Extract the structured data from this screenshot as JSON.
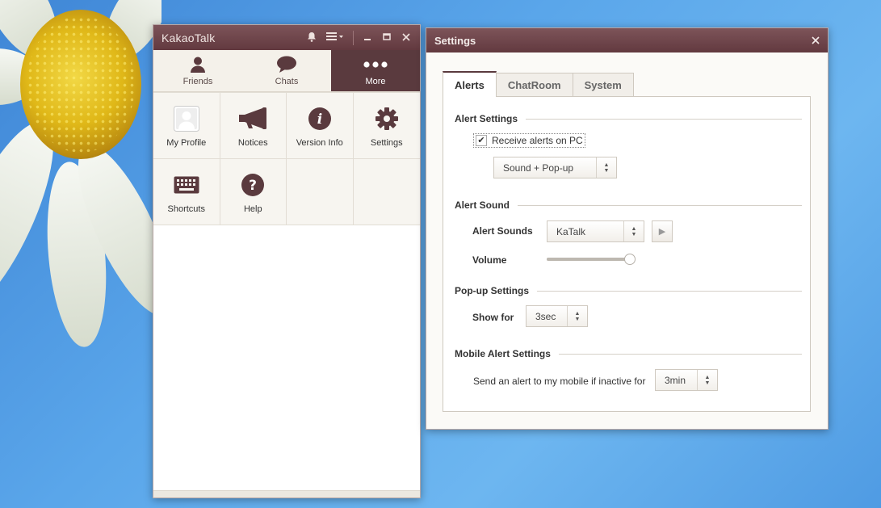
{
  "kakao": {
    "title": "KakaoTalk",
    "tabs": [
      {
        "label": "Friends",
        "icon": "person-icon"
      },
      {
        "label": "Chats",
        "icon": "speech-bubble-icon"
      },
      {
        "label": "More",
        "icon": "more-dots-icon",
        "active": true
      }
    ],
    "more_items": [
      {
        "label": "My Profile",
        "icon": "profile-avatar-icon"
      },
      {
        "label": "Notices",
        "icon": "megaphone-icon"
      },
      {
        "label": "Version Info",
        "icon": "info-icon"
      },
      {
        "label": "Settings",
        "icon": "gear-icon"
      },
      {
        "label": "Shortcuts",
        "icon": "keyboard-icon"
      },
      {
        "label": "Help",
        "icon": "question-icon"
      }
    ]
  },
  "settings": {
    "title": "Settings",
    "tabs": [
      "Alerts",
      "ChatRoom",
      "System"
    ],
    "active_tab": "Alerts",
    "alert_settings": {
      "heading": "Alert Settings",
      "receive_alerts_label": "Receive alerts on PC",
      "receive_alerts_checked": true,
      "mode_value": "Sound + Pop-up"
    },
    "alert_sound": {
      "heading": "Alert Sound",
      "sounds_label": "Alert Sounds",
      "sound_value": "KaTalk",
      "volume_label": "Volume",
      "volume_level": 1.0
    },
    "popup_settings": {
      "heading": "Pop-up Settings",
      "show_for_label": "Show for",
      "show_for_value": "3sec"
    },
    "mobile_alert": {
      "heading": "Mobile Alert Settings",
      "send_label": "Send an alert to my mobile if inactive for",
      "inactive_value": "3min"
    }
  },
  "colors": {
    "titlebar": "#62393f",
    "active_tab": "#5a3a3e",
    "desktop": "#5aa6ea"
  }
}
